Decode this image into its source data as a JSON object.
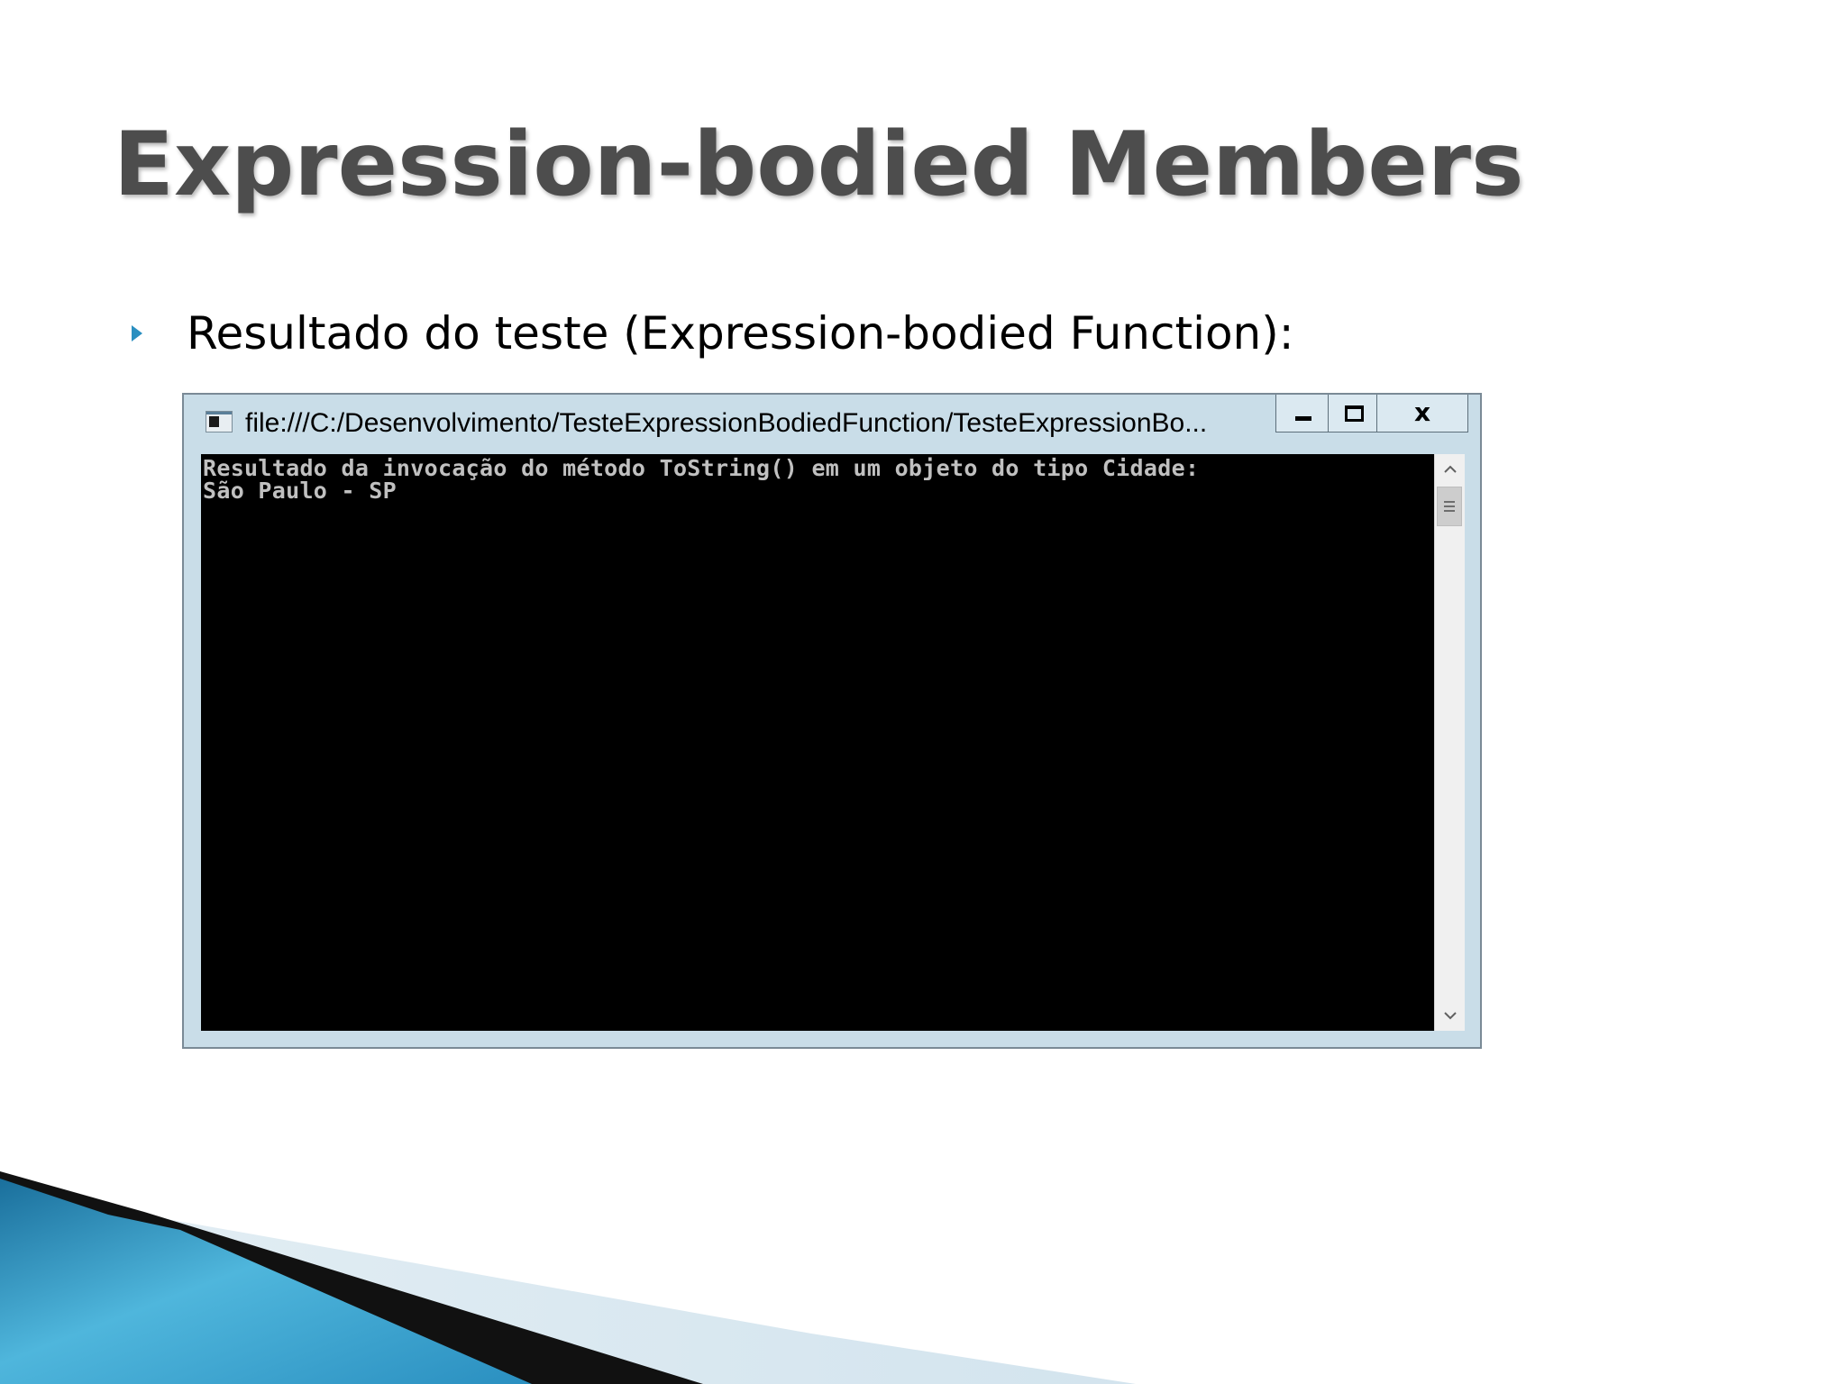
{
  "slide": {
    "title": "Expression-bodied Members",
    "bullet_text": "Resultado do teste (Expression-bodied Function):"
  },
  "console_window": {
    "title": "file:///C:/Desenvolvimento/TesteExpressionBodiedFunction/TesteExpressionBo...",
    "close_glyph": "x",
    "output_lines": [
      "Resultado da invocação do método ToString() em um objeto do tipo Cidade:",
      "São Paulo - SP"
    ],
    "scroll_up_glyph": "^",
    "scroll_down_glyph": "v"
  },
  "colors": {
    "title_text": "#4d4d4d",
    "bullet_marker": "#2a8fc0",
    "window_frame": "#c9dde8",
    "console_background": "#000000",
    "console_text": "#c0c0c0",
    "deco_blue": "#2a8fc0",
    "deco_black": "#111111",
    "deco_light": "#d6e6ef"
  },
  "icons": {
    "bullet": "triangle-right-icon",
    "window": "console-app-icon",
    "minimize": "minimize-icon",
    "maximize": "maximize-icon",
    "close": "close-icon",
    "scroll_up": "chevron-up-icon",
    "scroll_down": "chevron-down-icon"
  }
}
